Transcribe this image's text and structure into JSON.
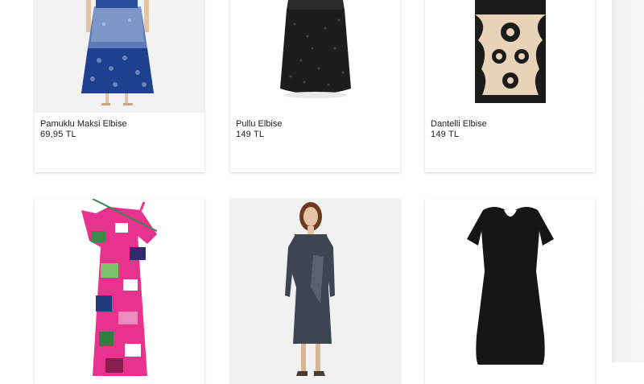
{
  "products": [
    {
      "name": "Pamuklu Maksi Elbise",
      "price": "69,95 TL",
      "image": "blue-patterned-maxi-dress"
    },
    {
      "name": "Pullu Elbise",
      "price": "149 TL",
      "image": "black-sequin-dress"
    },
    {
      "name": "Dantelli Elbise",
      "price": "149 TL",
      "image": "black-lace-beige-dress"
    },
    {
      "name": "",
      "price": "",
      "image": "pink-floral-one-shoulder-dress"
    },
    {
      "name": "",
      "price": "",
      "image": "grey-long-sleeve-dress-model"
    },
    {
      "name": "",
      "price": "",
      "image": "black-short-sleeve-dress"
    }
  ]
}
